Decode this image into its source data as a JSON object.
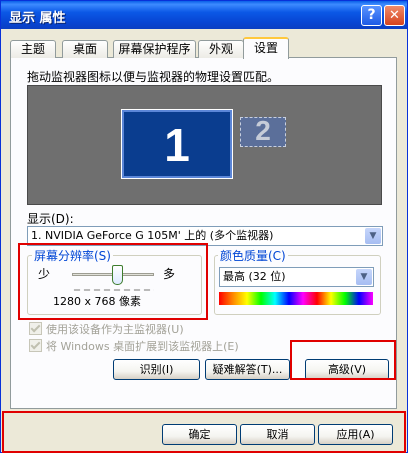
{
  "window": {
    "title": "显示 属性",
    "help_label": "?",
    "close_label": "✕"
  },
  "tabs": [
    {
      "label": "主题"
    },
    {
      "label": "桌面"
    },
    {
      "label": "屏幕保护程序"
    },
    {
      "label": "外观"
    },
    {
      "label": "设置"
    }
  ],
  "settings": {
    "description": "拖动监视器图标以便与监视器的物理设置匹配。",
    "monitor1_label": "1",
    "monitor2_label": "2",
    "display_label": "显示(D):",
    "display_value": "1. NVIDIA GeForce G 105M' 上的 (多个监视器)",
    "resolution": {
      "title": "屏幕分辨率(S)",
      "low_label": "少",
      "high_label": "多",
      "value_text": "1280 x 768 像素",
      "slider_level_fraction": 0.55
    },
    "color_quality": {
      "title": "颜色质量(C)",
      "selected": "最高 (32 位)"
    },
    "checkbox_primary": "使用该设备作为主监视器(U)",
    "checkbox_extend": "将 Windows 桌面扩展到该监视器上(E)",
    "buttons": {
      "identify": "识别(I)",
      "troubleshoot": "疑难解答(T)...",
      "advanced": "高级(V)"
    }
  },
  "footer": {
    "ok": "确定",
    "cancel": "取消",
    "apply": "应用(A)"
  },
  "colors": {
    "title_bar": "#0b58e6",
    "group_title": "#0046d5",
    "highlight_box": "#e00000",
    "monitor_area": "#6f6f6f"
  },
  "icons": {
    "help": "help-icon",
    "close": "close-icon",
    "dropdown": "chevron-down-icon"
  }
}
